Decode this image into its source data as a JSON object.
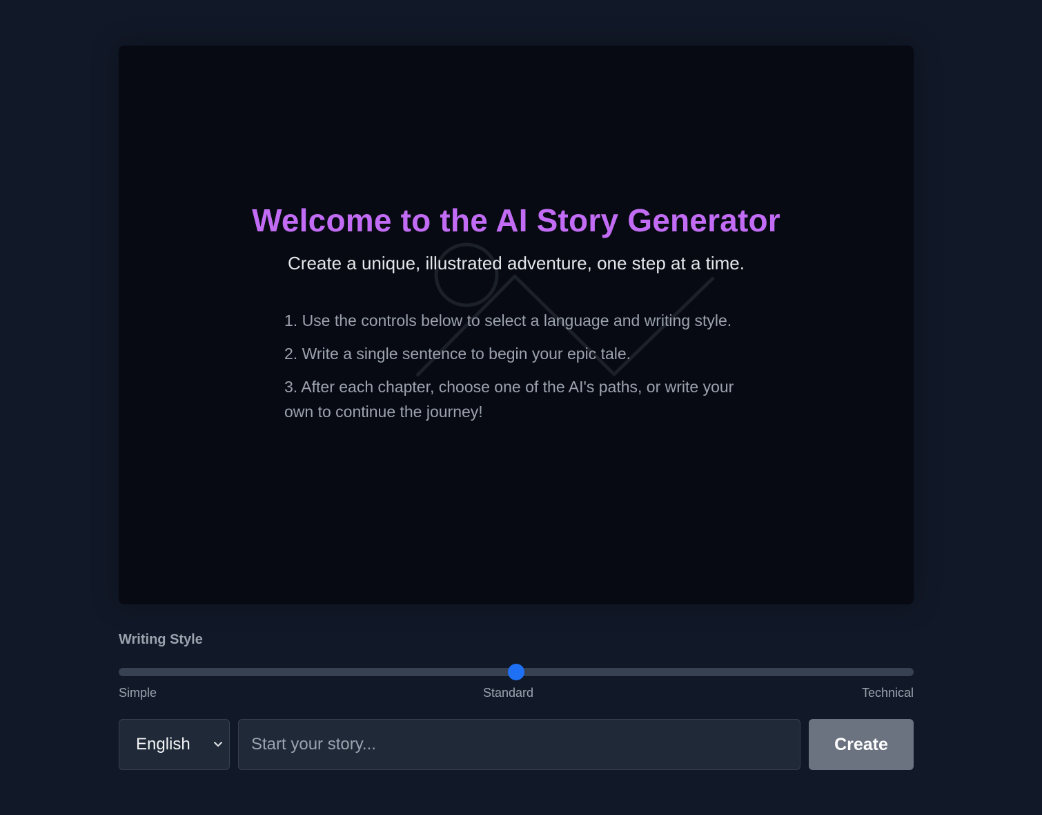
{
  "welcome": {
    "title": "Welcome to the AI Story Generator",
    "subtitle": "Create a unique, illustrated adventure, one step at a time.",
    "steps": [
      "1. Use the controls below to select a language and writing style.",
      "2. Write a single sentence to begin your epic tale.",
      "3. After each chapter, choose one of the AI's paths, or write your own to continue the journey!"
    ]
  },
  "writing_style": {
    "label": "Writing Style",
    "level": 0.5,
    "labels": {
      "simple": "Simple",
      "standard": "Standard",
      "technical": "Technical"
    }
  },
  "controls": {
    "language_value": "English",
    "story_placeholder": "Start your story...",
    "create_label": "Create"
  },
  "colors": {
    "accent_title": "#c26cf5",
    "slider_thumb": "#1e70f5",
    "button_bg": "#6b7280"
  },
  "icons": {
    "placeholder_art": "image-placeholder-icon",
    "select_arrow": "chevron-down-icon"
  }
}
